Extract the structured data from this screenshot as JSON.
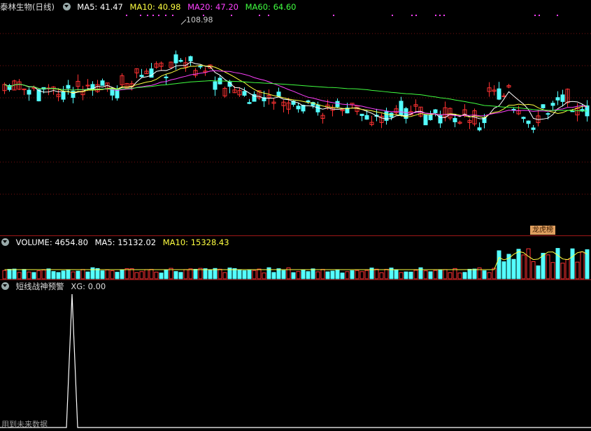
{
  "stock": {
    "name": "泰林生物",
    "period": "(日线)"
  },
  "price_indicators": [
    {
      "label": "MA5:",
      "value": "41.47",
      "color": "#ffffff"
    },
    {
      "label": "MA10:",
      "value": "40.98",
      "color": "#ffff40"
    },
    {
      "label": "MA20:",
      "value": "47.20",
      "color": "#ff40ff"
    },
    {
      "label": "MA60:",
      "value": "64.60",
      "color": "#40ff40"
    }
  ],
  "peak_price": "108.98",
  "badge": "龙虎榜",
  "volume_indicators": [
    {
      "label": "VOLUME:",
      "value": "4654.80",
      "color": "#ffffff"
    },
    {
      "label": "MA5:",
      "value": "15132.02",
      "color": "#ffffff"
    },
    {
      "label": "MA10:",
      "value": "15328.43",
      "color": "#ffff40"
    }
  ],
  "signal_indicator": {
    "name": "短线战神预警",
    "label": "XG:",
    "value": "0.00"
  },
  "footer_note": "用到未来数据",
  "colors": {
    "up": "#ff3232",
    "down": "#54ffff",
    "border": "#a01818"
  }
}
